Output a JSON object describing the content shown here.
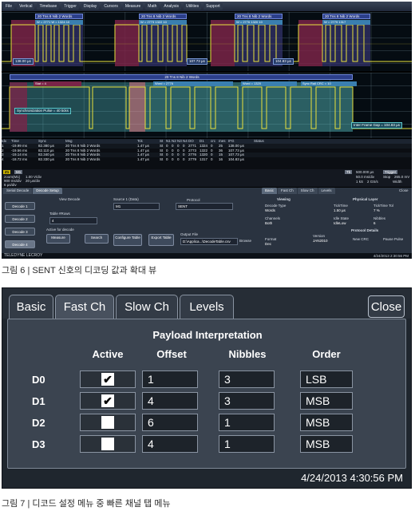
{
  "scope": {
    "menu": [
      "File",
      "Vertical",
      "Timebase",
      "Trigger",
      "Display",
      "Cursors",
      "Measure",
      "Math",
      "Analysis",
      "Utilities",
      "Support"
    ],
    "wave1_segments": [
      {
        "head": "20 Tns  8 Nib 2 Words",
        "sub": "W = 2771  W = 1324  10",
        "time": "138.00 µs"
      },
      {
        "head": "20 Tns  8 Nib 2 Words",
        "sub": "W = 2773  1322  10",
        "time": "107.73 µs"
      },
      {
        "head": "20 Tns  8 Nib 2 Words",
        "sub": "W = 2776  1320  10",
        "time": "104.83 µs"
      },
      {
        "head": "20 Tns  8 Nib 2 Words",
        "sub": "W = 2779  1317",
        "time": ""
      }
    ],
    "wave2": {
      "head": "20 Tns  8 Nib 2 Words",
      "sub_labels": [
        "Stat = 4",
        "Word = 2776",
        "Word = 1320",
        "Sync Rail CRC = 10"
      ],
      "pulse_label": "Synchronization Pulse = 40 ticks",
      "gap_label": "Inter Frame Gap = 104.83 µs"
    },
    "table": {
      "columns": [
        "Idx",
        "Time",
        "Sync",
        "Msg",
        "Tck",
        "St",
        "N1",
        "N2",
        "N3",
        "N4",
        "DO",
        "D1",
        "crc",
        "mes",
        "IFG",
        "Status"
      ],
      "rows": [
        [
          "1",
          "-19.99 ms",
          "82.380 µs",
          "20 Tns  8 Nib 2 Words",
          "1.47 µs",
          "St",
          "0",
          "0",
          "0",
          "0",
          "2771",
          "1324",
          "0",
          "25",
          "138.00 µs",
          ""
        ],
        [
          "2",
          "-19.56 ms",
          "82.110 µs",
          "20 Tns  8 Nib 2 Words",
          "1.47 µs",
          "St",
          "0",
          "0",
          "0",
          "0",
          "2773",
          "1322",
          "0",
          "36",
          "107.73 µs",
          ""
        ],
        [
          "3",
          "-19.14 ms",
          "82.340 µs",
          "20 Tns  8 Nib 2 Words",
          "1.47 µs",
          "St",
          "0",
          "0",
          "0",
          "0",
          "2776",
          "1320",
          "0",
          "15",
          "107.73 µs",
          ""
        ],
        [
          "4",
          "-18.72 ms",
          "82.330 µs",
          "20 Tns  8 Nib 2 Words",
          "1.47 µs",
          "St",
          "0",
          "0",
          "0",
          "0",
          "2779",
          "1317",
          "0",
          "16",
          "104.83 µs",
          ""
        ]
      ]
    },
    "readouts": {
      "z1_tag": "Z1",
      "m1_tag": "M1",
      "z1_lines": [
        "zoom(M1)",
        "900 ms/div",
        "6 µs/div"
      ],
      "m1_lines": [
        "1.00 V/div",
        "20 µs/div"
      ],
      "tb": "Tb",
      "tb_value": "500.000 µs",
      "trigger": "Trigger",
      "trig_mode": "Stop",
      "trig_level": "265.0 mV",
      "sample_rate": "50.0 ms/div",
      "samples": "1 kS",
      "rate2": "2 GS/s",
      "edge": "Width"
    },
    "dialog": {
      "left_tabs": [
        "Serial Decode",
        "Decode Setup"
      ],
      "right_tabs": [
        "Basic",
        "Fast Ch",
        "Slow Ch",
        "Levels"
      ],
      "close": "Close",
      "decodes": [
        "Decode 1",
        "Decode 2",
        "Decode 3",
        "Decode 4"
      ],
      "view_decode": "View Decode",
      "source": "Source 1 (Data)",
      "source_value": "M1",
      "protocol_label": "Protocol",
      "protocol_value": "SENT",
      "table_rows_label": "Table #Rows",
      "table_rows_value": "4",
      "active_for": "Active for decode",
      "measure": "Measure",
      "search": "Search",
      "configure": "Configure Table",
      "export": "Export Table",
      "output_file": "Output File",
      "output_path": "D:\\Applica...\\DecodeTable.csv",
      "browse": "Browse",
      "viewing": "Viewing",
      "decode_type_l": "Decode Type",
      "decode_type_v": "Words",
      "channels_l": "Channels",
      "channels_v": "Both",
      "format_l": "Format",
      "format_v": "Dec",
      "physical": "Physical Layer",
      "ticktime_l": "TickTime",
      "ticktime_v": "1.50 µs",
      "ticktol_l": "TickTime Tol",
      "ticktol_v": "7 %",
      "idle_l": "Idle State",
      "idle_v": "IdleLow",
      "nibbles_l": "Nibbles",
      "nibbles_v": "6",
      "protocol_details": "Protocol Details",
      "version_l": "Version",
      "version_v": "JAN2010",
      "newcrc": "New CRC",
      "pause": "Pause Pulse"
    },
    "logo": "TELEDYNE LECROY",
    "stamp": "4/24/2013 2:30:56 PM"
  },
  "captions": {
    "fig6": "그림 6 | SENT 신호의 디코딩 값과 확대 뷰",
    "fig7": "그림 7 | 디코드 설정 메뉴 중 빠른 채널 탭 메뉴"
  },
  "zoom": {
    "tabs": [
      "Basic",
      "Fast Ch",
      "Slow Ch",
      "Levels"
    ],
    "active_tab": "Fast Ch",
    "close": "Close",
    "title": "Payload Interpretation",
    "headers": {
      "active": "Active",
      "offset": "Offset",
      "nibbles": "Nibbles",
      "order": "Order"
    },
    "rows": [
      {
        "label": "D0",
        "active": true,
        "offset": "1",
        "nibbles": "3",
        "order": "LSB"
      },
      {
        "label": "D1",
        "active": true,
        "offset": "4",
        "nibbles": "3",
        "order": "MSB"
      },
      {
        "label": "D2",
        "active": false,
        "offset": "6",
        "nibbles": "1",
        "order": "MSB"
      },
      {
        "label": "D3",
        "active": false,
        "offset": "4",
        "nibbles": "1",
        "order": "MSB"
      }
    ],
    "timestamp": "4/24/2013 4:30:56 PM",
    "check_glyph": "✔"
  }
}
